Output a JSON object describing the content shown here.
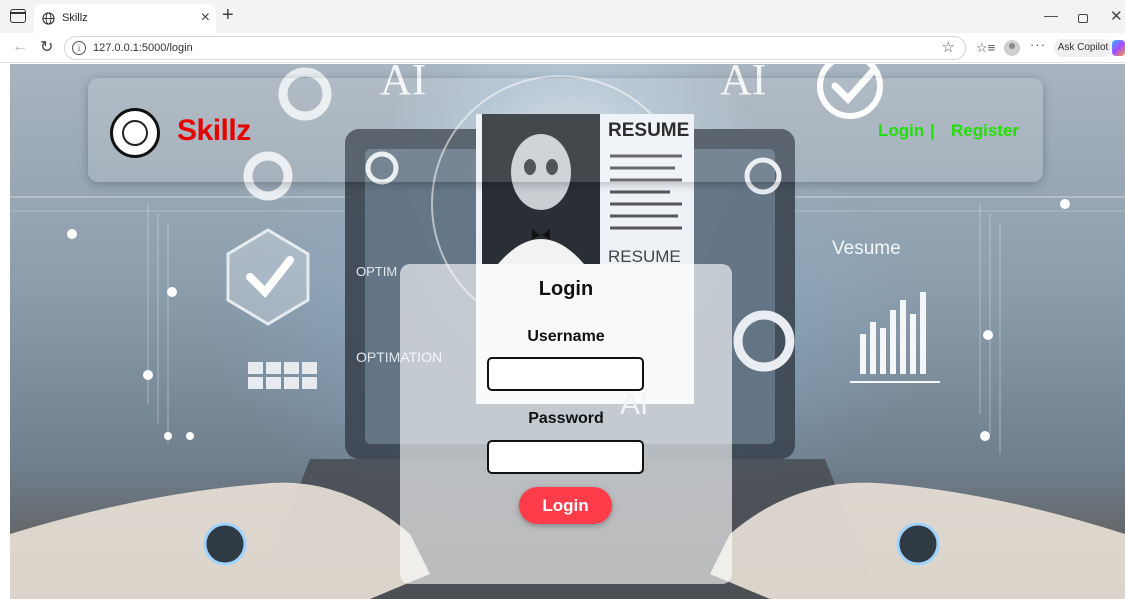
{
  "browser": {
    "tab_title": "Skillz",
    "url": "127.0.0.1:5000/login",
    "copilot_label": "Ask Copilot",
    "colors": {
      "tabstrip": "#f3f3f3",
      "toolbar": "#ffffff"
    }
  },
  "header": {
    "brand": "Skillz",
    "nav_login": "Login",
    "nav_separator": "|",
    "nav_register": "Register",
    "colors": {
      "brand": "#e60000",
      "nav": "#22e000"
    }
  },
  "background_art": {
    "word_ai_left": "AI",
    "word_ai_right": "AI",
    "resume_heading": "RESUME",
    "resume_subheading": "RESUME",
    "word_vesume": "Vesume",
    "word_optim": "OPTIM",
    "word_optimation": "OPTIMATION",
    "word_ai_screen": "AI"
  },
  "login_form": {
    "title": "Login",
    "username_label": "Username",
    "username_value": "",
    "password_label": "Password",
    "password_value": "",
    "submit_label": "Login",
    "colors": {
      "submit": "#ff3d4a"
    }
  }
}
